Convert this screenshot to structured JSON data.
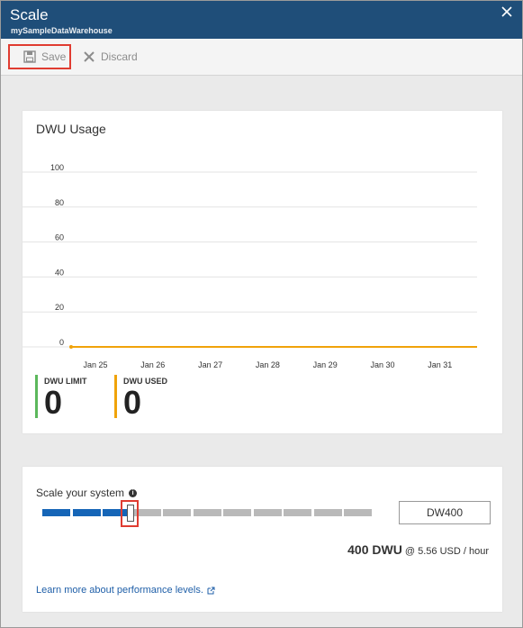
{
  "header": {
    "title": "Scale",
    "subtitle": "mySampleDataWarehouse",
    "close_icon": "close-icon"
  },
  "toolbar": {
    "save_label": "Save",
    "discard_label": "Discard"
  },
  "usage_card": {
    "title": "DWU Usage",
    "limit_label": "DWU LIMIT",
    "limit_value": "0",
    "used_label": "DWU USED",
    "used_value": "0"
  },
  "chart_data": {
    "type": "line",
    "title": "DWU Usage",
    "xlabel": "",
    "ylabel": "",
    "ylim": [
      0,
      100
    ],
    "yticks": [
      0,
      20,
      40,
      60,
      80,
      100
    ],
    "categories": [
      "Jan 25",
      "Jan 26",
      "Jan 27",
      "Jan 28",
      "Jan 29",
      "Jan 30",
      "Jan 31"
    ],
    "grid": true,
    "series": [
      {
        "name": "DWU LIMIT",
        "color": "#5cb85c",
        "values": [
          0,
          0,
          0,
          0,
          0,
          0,
          0
        ]
      },
      {
        "name": "DWU USED",
        "color": "#f0a30a",
        "values": [
          0,
          0,
          0,
          0,
          0,
          0,
          0
        ]
      }
    ]
  },
  "scale_card": {
    "label": "Scale your system",
    "info_glyph": "i",
    "slider_level_fraction": 0.3,
    "slider_filled_segments": 3,
    "slider_total_segments": 11,
    "slider_filled_color": "#1565b7",
    "slider_empty_color": "#b9b9b9",
    "dw_value": "DW400",
    "price_main": "400 DWU",
    "price_detail": "@ 5.56 USD / hour",
    "learn_more": "Learn more about performance levels."
  },
  "colors": {
    "header_bg": "#1f4e79",
    "highlight_border": "#e03c31",
    "link": "#1f5fa8",
    "limit": "#5cb85c",
    "used": "#f0a30a"
  }
}
